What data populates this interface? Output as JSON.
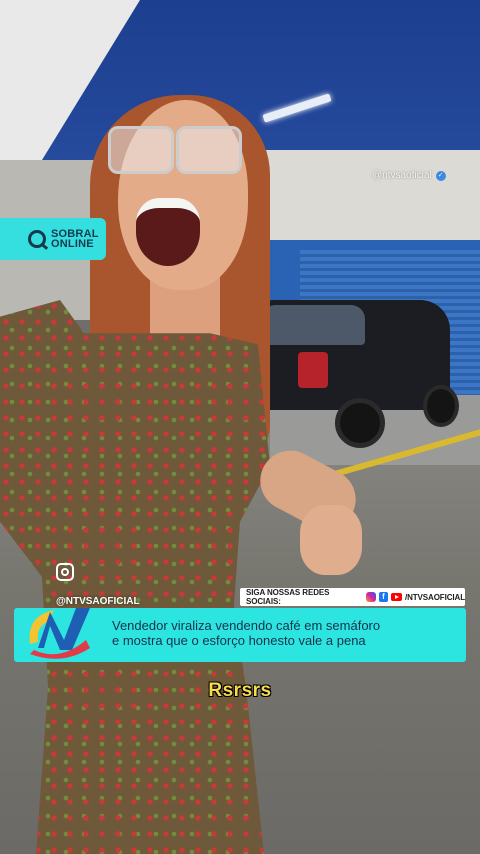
{
  "watermark": {
    "brand_line1": "SOBRAL",
    "brand_line2": "ONLINE",
    "top_handle": "@ntvsaoficial"
  },
  "lower_third": {
    "channel_handle": "@NTVSAOFICIAL",
    "social_label": "SIGA NOSSAS REDES SOCIAIS:",
    "social_handle": "/NTVSAOFICIAL",
    "headline_line1": "Vendedor viraliza vendendo café em semáforo",
    "headline_line2": "e mostra que o esforço honesto vale a pena",
    "icons": [
      "instagram-icon",
      "facebook-icon",
      "youtube-icon"
    ]
  },
  "subtitle": "Rsrsrs",
  "colors": {
    "accent": "#2de5e0",
    "caption": "#f7dd4d",
    "verified": "#3d8ae6"
  }
}
